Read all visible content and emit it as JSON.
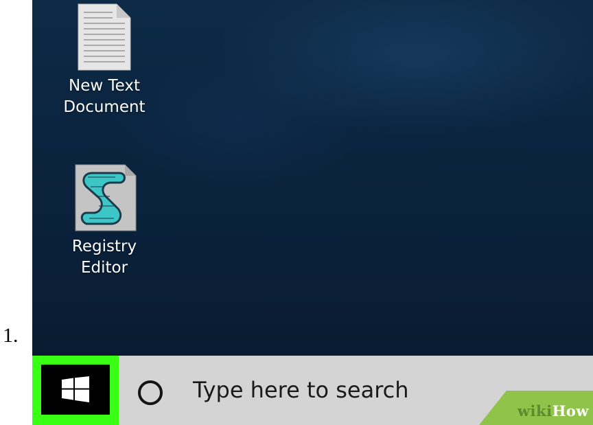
{
  "list_marker": "1.",
  "desktop": {
    "icons": [
      {
        "name": "text-document",
        "label_line1": "New Text",
        "label_line2": "Document",
        "icon": "text-document-icon"
      },
      {
        "name": "registry-editor",
        "label_line1": "Registry",
        "label_line2": "Editor",
        "icon": "registry-editor-icon"
      }
    ]
  },
  "taskbar": {
    "start_icon": "windows-logo-icon",
    "highlight_color": "#39ff14",
    "search": {
      "icon": "cortana-circle-icon",
      "placeholder": "Type here to search"
    }
  },
  "watermark": {
    "part1": "wiki",
    "part2": "How"
  }
}
